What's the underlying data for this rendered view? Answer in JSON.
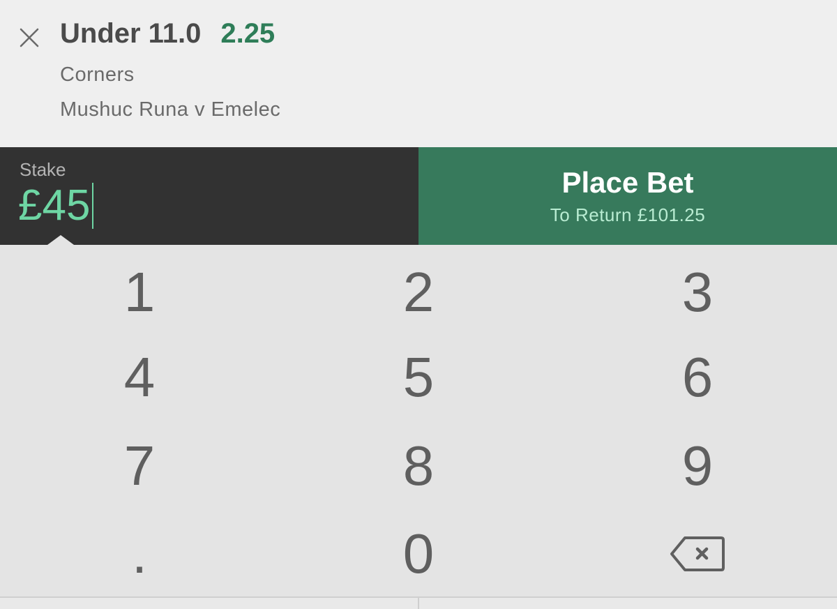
{
  "selection": {
    "name": "Under 11.0",
    "odds": "2.25",
    "market": "Corners",
    "event": "Mushuc Runa v Emelec"
  },
  "stake": {
    "label": "Stake",
    "value": "£45"
  },
  "place_bet": {
    "label": "Place Bet",
    "return_text": "To Return £101.25"
  },
  "keypad": {
    "keys": [
      "1",
      "2",
      "3",
      "4",
      "5",
      "6",
      "7",
      "8",
      "9",
      ".",
      "0"
    ],
    "backspace_icon": "backspace-icon"
  },
  "colors": {
    "accent_green": "#2e7d58",
    "place_bet_bg": "#377a5c",
    "stake_value": "#6ed6a4",
    "stake_panel_bg": "#323232"
  }
}
